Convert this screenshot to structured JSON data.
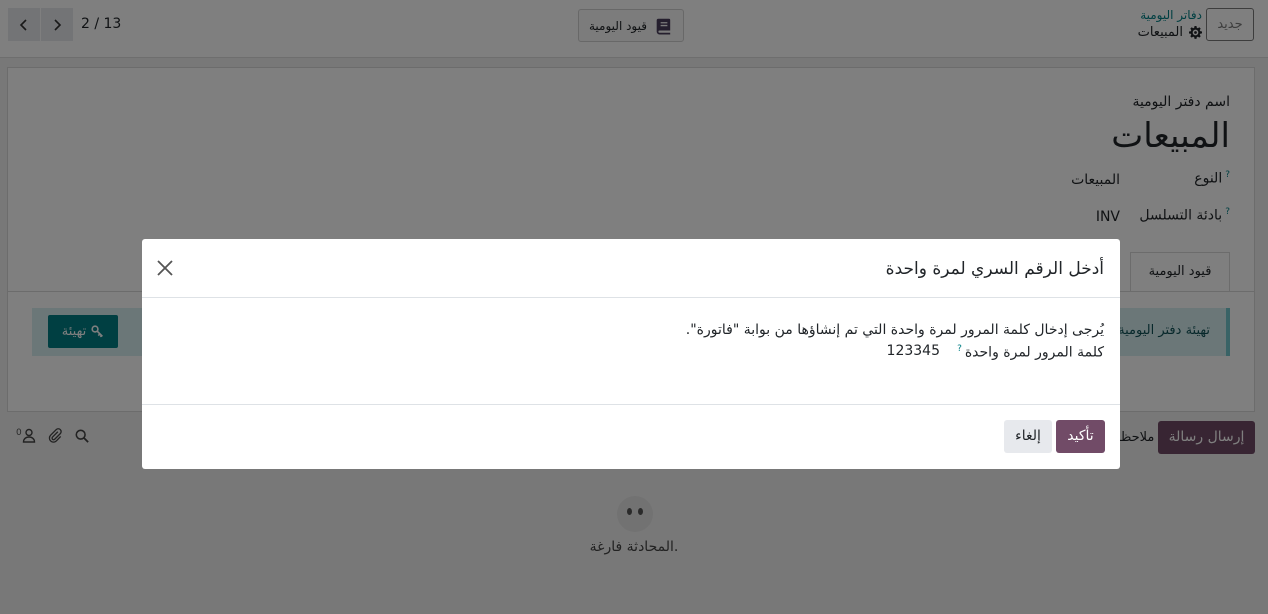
{
  "control_panel": {
    "new_button": "جديد",
    "breadcrumb_parent": "دفاتر اليومية",
    "breadcrumb_current": "المبيعات",
    "smart_button": "قيود اليومية",
    "pager_value": "2 / 13"
  },
  "form": {
    "name_label": "اسم دفتر اليومية",
    "name_value": "المبيعات",
    "type_label": "النوع",
    "type_help": "?",
    "type_value": "المبيعات",
    "seq_label": "بادئة التسلسل",
    "seq_help": "?",
    "seq_value": "INV",
    "tab_label": "قيود اليومية",
    "alert_text": "تهيئة دفتر اليومية",
    "setup_button": "تهيئة"
  },
  "chatter": {
    "send_message": "إرسال رسالة",
    "log_note": "ملاحظة",
    "followers_count": "0",
    "empty_text": "المحادثة فارغة."
  },
  "dialog": {
    "title": "أدخل الرقم السري لمرة واحدة",
    "description": "يُرجى إدخال كلمة المرور لمرة واحدة التي تم إنشاؤها من بوابة \"فاتورة\".",
    "field_label": "كلمة المرور لمرة واحدة",
    "field_help": "?",
    "field_value": "123345",
    "confirm": "تأكيد",
    "cancel": "إلغاء"
  }
}
